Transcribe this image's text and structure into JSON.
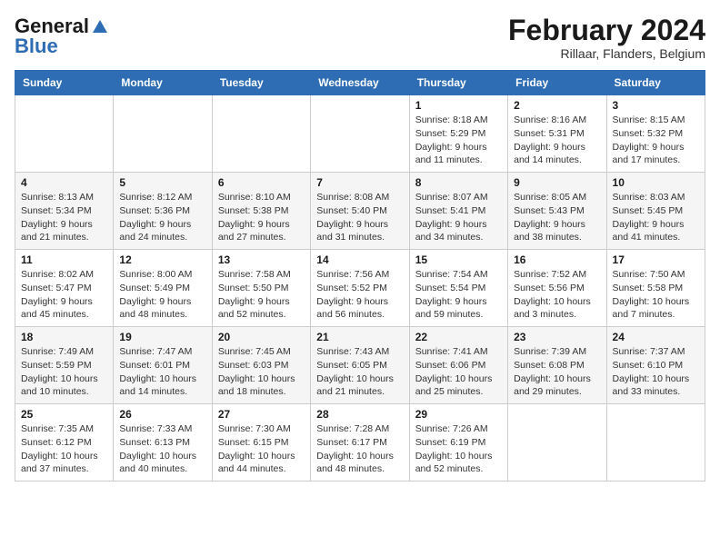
{
  "logo": {
    "line1": "General",
    "line2": "Blue"
  },
  "title": "February 2024",
  "subtitle": "Rillaar, Flanders, Belgium",
  "days_of_week": [
    "Sunday",
    "Monday",
    "Tuesday",
    "Wednesday",
    "Thursday",
    "Friday",
    "Saturday"
  ],
  "weeks": [
    [
      {
        "day": "",
        "info": ""
      },
      {
        "day": "",
        "info": ""
      },
      {
        "day": "",
        "info": ""
      },
      {
        "day": "",
        "info": ""
      },
      {
        "day": "1",
        "info": "Sunrise: 8:18 AM\nSunset: 5:29 PM\nDaylight: 9 hours\nand 11 minutes."
      },
      {
        "day": "2",
        "info": "Sunrise: 8:16 AM\nSunset: 5:31 PM\nDaylight: 9 hours\nand 14 minutes."
      },
      {
        "day": "3",
        "info": "Sunrise: 8:15 AM\nSunset: 5:32 PM\nDaylight: 9 hours\nand 17 minutes."
      }
    ],
    [
      {
        "day": "4",
        "info": "Sunrise: 8:13 AM\nSunset: 5:34 PM\nDaylight: 9 hours\nand 21 minutes."
      },
      {
        "day": "5",
        "info": "Sunrise: 8:12 AM\nSunset: 5:36 PM\nDaylight: 9 hours\nand 24 minutes."
      },
      {
        "day": "6",
        "info": "Sunrise: 8:10 AM\nSunset: 5:38 PM\nDaylight: 9 hours\nand 27 minutes."
      },
      {
        "day": "7",
        "info": "Sunrise: 8:08 AM\nSunset: 5:40 PM\nDaylight: 9 hours\nand 31 minutes."
      },
      {
        "day": "8",
        "info": "Sunrise: 8:07 AM\nSunset: 5:41 PM\nDaylight: 9 hours\nand 34 minutes."
      },
      {
        "day": "9",
        "info": "Sunrise: 8:05 AM\nSunset: 5:43 PM\nDaylight: 9 hours\nand 38 minutes."
      },
      {
        "day": "10",
        "info": "Sunrise: 8:03 AM\nSunset: 5:45 PM\nDaylight: 9 hours\nand 41 minutes."
      }
    ],
    [
      {
        "day": "11",
        "info": "Sunrise: 8:02 AM\nSunset: 5:47 PM\nDaylight: 9 hours\nand 45 minutes."
      },
      {
        "day": "12",
        "info": "Sunrise: 8:00 AM\nSunset: 5:49 PM\nDaylight: 9 hours\nand 48 minutes."
      },
      {
        "day": "13",
        "info": "Sunrise: 7:58 AM\nSunset: 5:50 PM\nDaylight: 9 hours\nand 52 minutes."
      },
      {
        "day": "14",
        "info": "Sunrise: 7:56 AM\nSunset: 5:52 PM\nDaylight: 9 hours\nand 56 minutes."
      },
      {
        "day": "15",
        "info": "Sunrise: 7:54 AM\nSunset: 5:54 PM\nDaylight: 9 hours\nand 59 minutes."
      },
      {
        "day": "16",
        "info": "Sunrise: 7:52 AM\nSunset: 5:56 PM\nDaylight: 10 hours\nand 3 minutes."
      },
      {
        "day": "17",
        "info": "Sunrise: 7:50 AM\nSunset: 5:58 PM\nDaylight: 10 hours\nand 7 minutes."
      }
    ],
    [
      {
        "day": "18",
        "info": "Sunrise: 7:49 AM\nSunset: 5:59 PM\nDaylight: 10 hours\nand 10 minutes."
      },
      {
        "day": "19",
        "info": "Sunrise: 7:47 AM\nSunset: 6:01 PM\nDaylight: 10 hours\nand 14 minutes."
      },
      {
        "day": "20",
        "info": "Sunrise: 7:45 AM\nSunset: 6:03 PM\nDaylight: 10 hours\nand 18 minutes."
      },
      {
        "day": "21",
        "info": "Sunrise: 7:43 AM\nSunset: 6:05 PM\nDaylight: 10 hours\nand 21 minutes."
      },
      {
        "day": "22",
        "info": "Sunrise: 7:41 AM\nSunset: 6:06 PM\nDaylight: 10 hours\nand 25 minutes."
      },
      {
        "day": "23",
        "info": "Sunrise: 7:39 AM\nSunset: 6:08 PM\nDaylight: 10 hours\nand 29 minutes."
      },
      {
        "day": "24",
        "info": "Sunrise: 7:37 AM\nSunset: 6:10 PM\nDaylight: 10 hours\nand 33 minutes."
      }
    ],
    [
      {
        "day": "25",
        "info": "Sunrise: 7:35 AM\nSunset: 6:12 PM\nDaylight: 10 hours\nand 37 minutes."
      },
      {
        "day": "26",
        "info": "Sunrise: 7:33 AM\nSunset: 6:13 PM\nDaylight: 10 hours\nand 40 minutes."
      },
      {
        "day": "27",
        "info": "Sunrise: 7:30 AM\nSunset: 6:15 PM\nDaylight: 10 hours\nand 44 minutes."
      },
      {
        "day": "28",
        "info": "Sunrise: 7:28 AM\nSunset: 6:17 PM\nDaylight: 10 hours\nand 48 minutes."
      },
      {
        "day": "29",
        "info": "Sunrise: 7:26 AM\nSunset: 6:19 PM\nDaylight: 10 hours\nand 52 minutes."
      },
      {
        "day": "",
        "info": ""
      },
      {
        "day": "",
        "info": ""
      }
    ]
  ]
}
